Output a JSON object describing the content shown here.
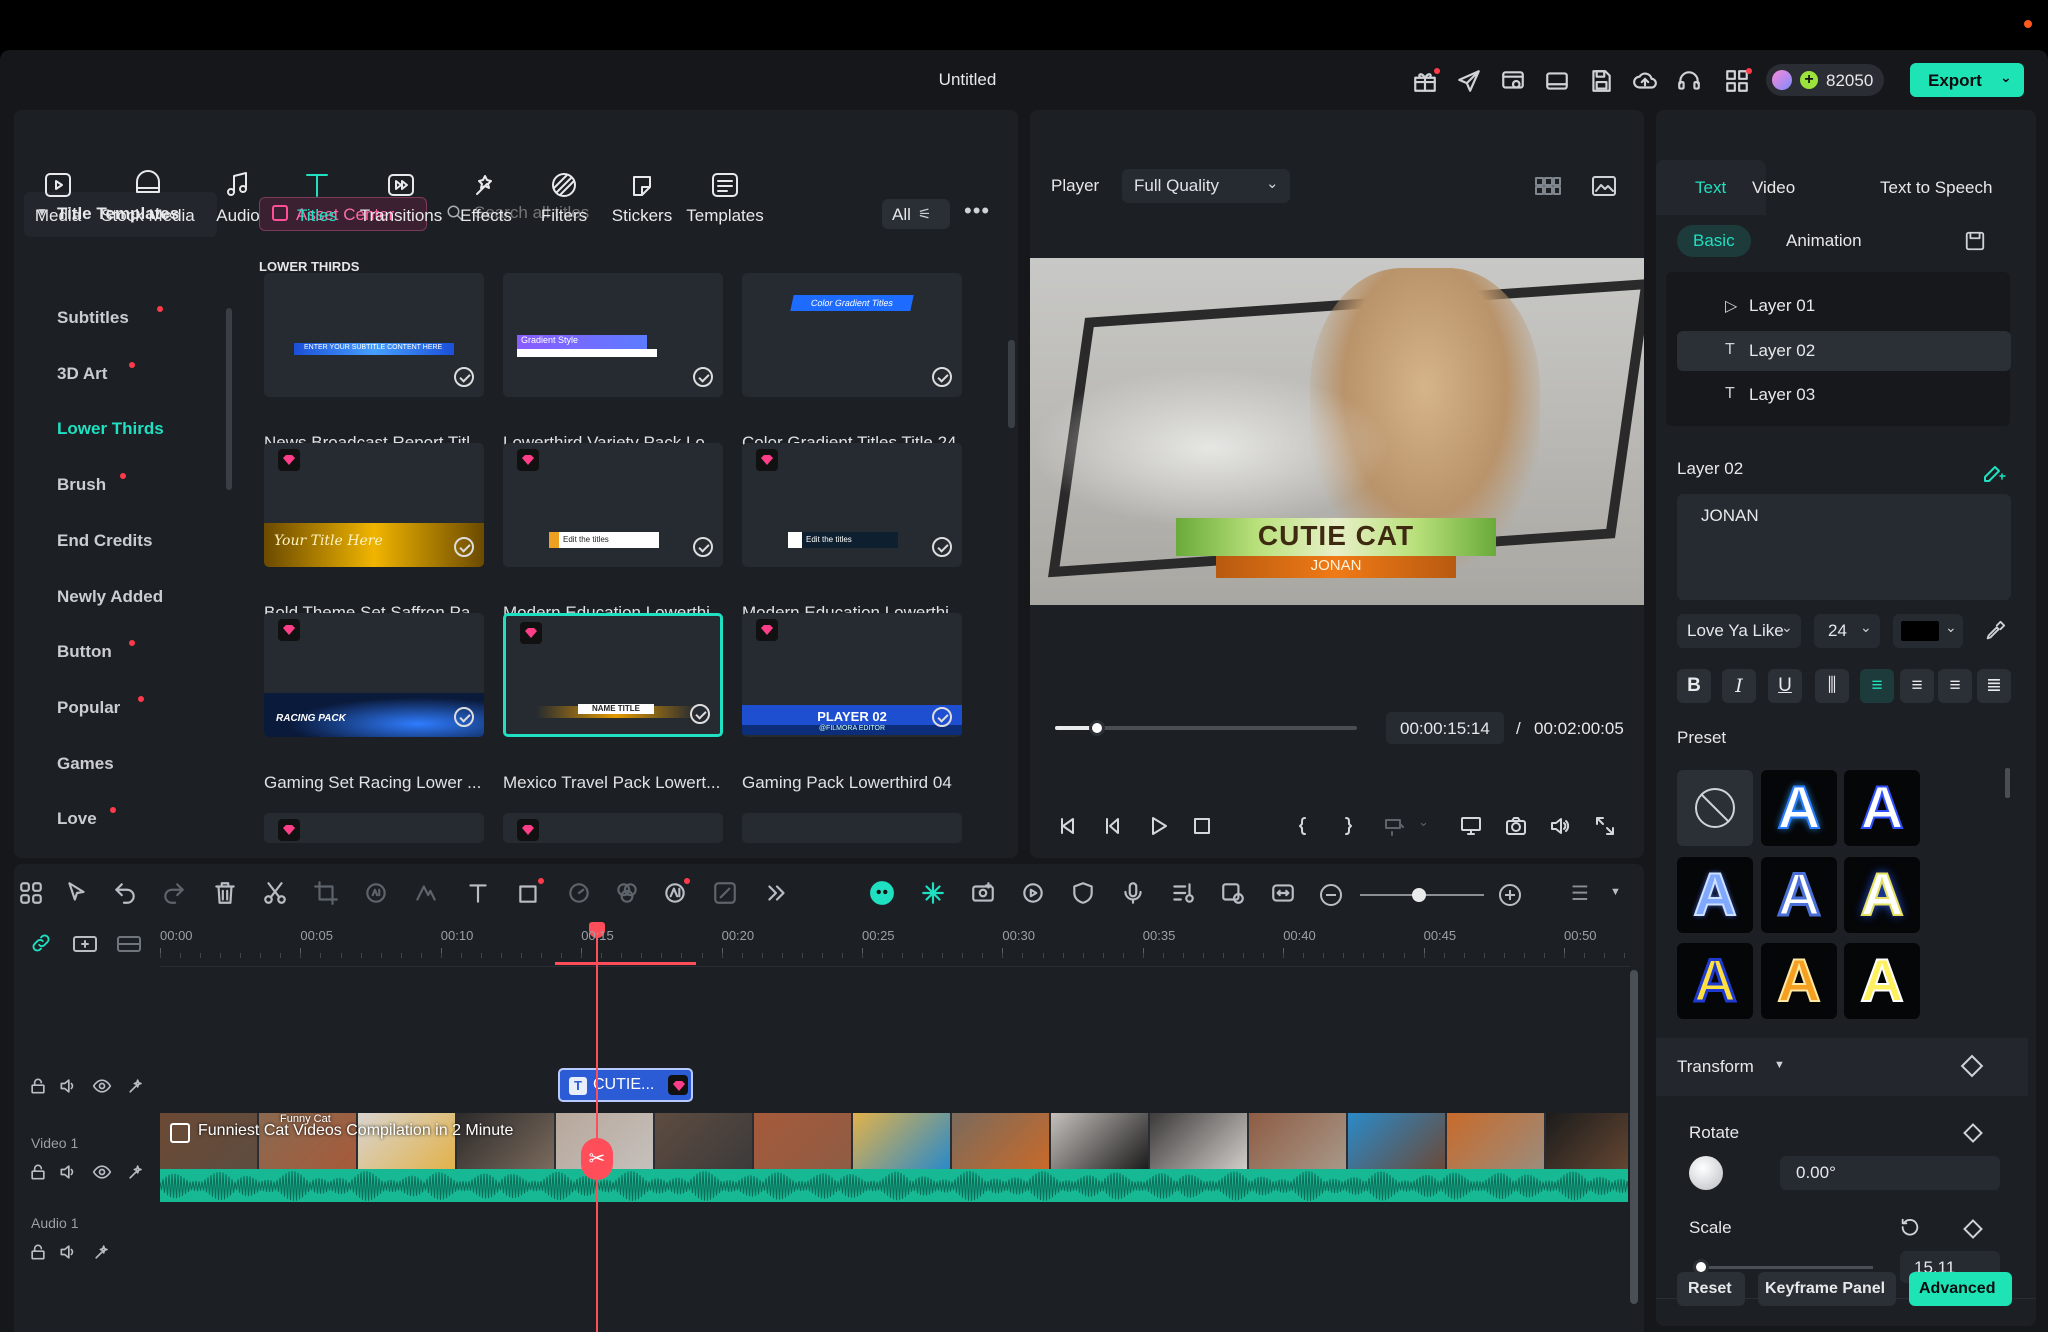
{
  "window": {
    "title": "Untitled"
  },
  "header": {
    "credits": "82050",
    "export_label": "Export"
  },
  "nav": {
    "tabs": [
      {
        "label": "Media",
        "icon": "media-icon"
      },
      {
        "label": "Stock Media",
        "icon": "stock-media-icon"
      },
      {
        "label": "Audio",
        "icon": "audio-icon"
      },
      {
        "label": "Titles",
        "icon": "titles-icon"
      },
      {
        "label": "Transitions",
        "icon": "transitions-icon"
      },
      {
        "label": "Effects",
        "icon": "effects-icon"
      },
      {
        "label": "Filters",
        "icon": "filters-icon"
      },
      {
        "label": "Stickers",
        "icon": "stickers-icon"
      },
      {
        "label": "Templates",
        "icon": "templates-icon"
      }
    ],
    "active": "Titles"
  },
  "sidebar": {
    "heading": "Title Templates",
    "items": [
      {
        "label": "Subtitles",
        "dot": true
      },
      {
        "label": "3D Art",
        "dot": true
      },
      {
        "label": "Lower Thirds",
        "dot": false,
        "active": true
      },
      {
        "label": "Brush",
        "dot": true
      },
      {
        "label": "End Credits",
        "dot": false
      },
      {
        "label": "Newly Added",
        "dot": false
      },
      {
        "label": "Button",
        "dot": true
      },
      {
        "label": "Popular",
        "dot": true
      },
      {
        "label": "Games",
        "dot": false
      },
      {
        "label": "Love",
        "dot": true
      }
    ]
  },
  "library": {
    "asset_center_label": "Asset Center",
    "search_placeholder": "Search all titles",
    "filter_label": "All",
    "section": "LOWER THIRDS",
    "items": [
      {
        "label": "News Broadcast Report Titl...",
        "art": "ENTER YOUR SUBTITLE CONTENT HERE",
        "premium": false
      },
      {
        "label": "Lowerthird Variety Pack Lo...",
        "art": "Gradient Style",
        "premium": false
      },
      {
        "label": "Color Gradient Titles Title 24",
        "art": "Color Gradient Titles",
        "premium": false
      },
      {
        "label": "Bold Theme Set Saffron Pa...",
        "art": "Your Title Here",
        "premium": true
      },
      {
        "label": "Modern Education Lowerthi...",
        "art": "Edit the titles",
        "premium": true
      },
      {
        "label": "Modern Education Lowerthi...",
        "art": "Edit the titles",
        "premium": true
      },
      {
        "label": "Gaming Set Racing Lower ...",
        "art": "RACING PACK",
        "premium": true
      },
      {
        "label": "Mexico Travel Pack Lowert...",
        "art": "NAME TITLE",
        "premium": true,
        "selected": true
      },
      {
        "label": "Gaming Pack Lowerthird 04",
        "art": "PLAYER 02",
        "art_sub": "@FILMORA EDITOR",
        "premium": true
      }
    ]
  },
  "player": {
    "label": "Player",
    "quality": "Full Quality",
    "overlay_title": "CUTIE CAT",
    "overlay_sub": "JONAN",
    "current_time": "00:00:15:14",
    "separator": "/",
    "total_time": "00:02:00:05",
    "progress": 0.14
  },
  "timeline": {
    "ruler": [
      "00:00",
      "00:05",
      "00:10",
      "00:15",
      "00:20",
      "00:25",
      "00:30",
      "00:35",
      "00:40",
      "00:45",
      "00:50"
    ],
    "title_clip": "CUTIE...",
    "video_track_label": "Video 1",
    "audio_track_label": "Audio 1",
    "video_clip_title": "Funniest Cat Videos Compilation in 2 Minute",
    "video_clip_overlay": "Funny Cat",
    "add_track": "+"
  },
  "inspector": {
    "tabs": [
      "Text",
      "Video",
      "Text to Speech"
    ],
    "subtabs": [
      "Basic",
      "Animation"
    ],
    "layers": [
      "Layer 01",
      "Layer 02",
      "Layer 03"
    ],
    "selected_layer": "Layer 02",
    "layer_heading": "Layer 02",
    "text_value": "JONAN",
    "font": "Love Ya Like",
    "font_size": "24",
    "color": "#000000",
    "preset_label": "Preset",
    "transform_label": "Transform",
    "rotate_label": "Rotate",
    "rotate_value": "0.00°",
    "scale_label": "Scale",
    "scale_value": "15.11",
    "buttons": {
      "reset": "Reset",
      "keyframe": "Keyframe Panel",
      "advanced": "Advanced"
    }
  },
  "colors": {
    "accent": "#1fe0c0",
    "export": "#1de3b5",
    "playhead": "#ff4d5a",
    "audio_wave": "#17b894",
    "title_clip": "#2c5bd6",
    "premium": "#ff3e8a"
  }
}
